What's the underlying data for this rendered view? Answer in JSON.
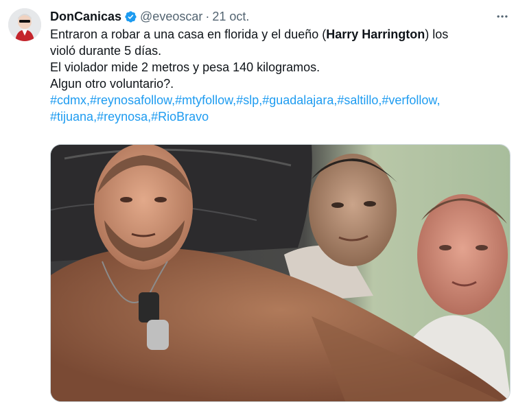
{
  "author": {
    "display_name": "DonCanicas",
    "handle": "@eveoscar",
    "separator": "·",
    "date": "21 oct.",
    "verified": true,
    "verified_color": "#1d9bf0"
  },
  "more_icon": "ellipsis-horizontal-icon",
  "tweet": {
    "line1_pre": "Entraron a robar a una casa en florida y el dueño (",
    "line1_bold": "Harry Harrington",
    "line1_post": ") los",
    "line2": "violó durante 5 días.",
    "line3": "El violador mide 2 metros y pesa 140 kilogramos.",
    "line4": "Algun otro voluntario?.",
    "hashtags_row1": [
      "#cdmx",
      "#reynosafollow",
      "#mtyfollow",
      "#slp",
      "#guadalajara",
      "#saltillo",
      "#verfollow"
    ],
    "hashtags_row2": [
      "#tijuana",
      "#reynosa",
      "#RioBravo"
    ],
    "hashtag_separator": ","
  },
  "colors": {
    "link": "#1d9bf0",
    "secondary_text": "#536471",
    "primary_text": "#0f1419"
  },
  "media": {
    "kind": "photo",
    "depicts": "three-men-photo"
  }
}
